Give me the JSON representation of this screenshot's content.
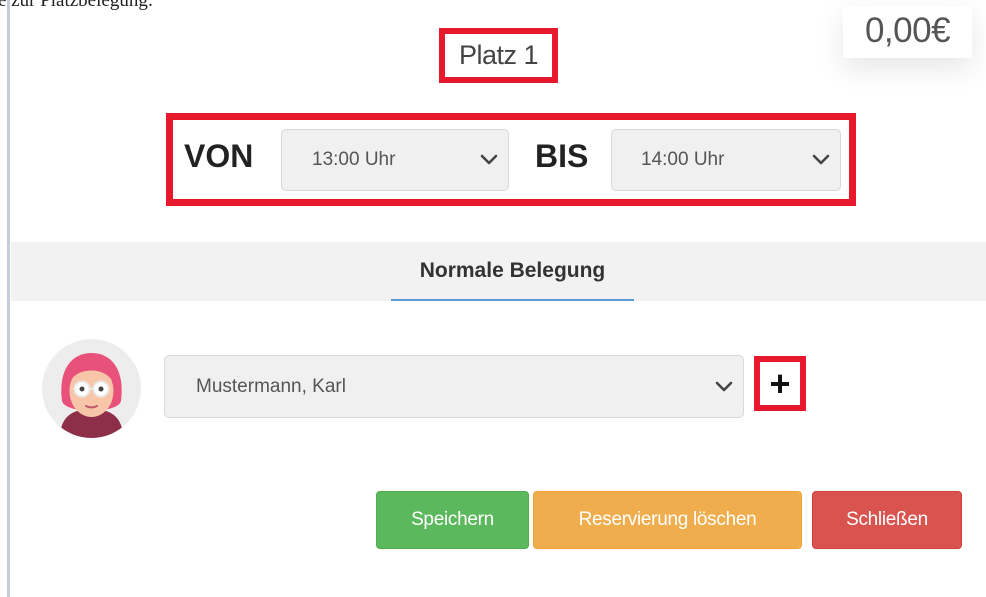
{
  "header": {
    "clipped_text": "e zur Platzbelegung:",
    "price": "0,00€",
    "place_title": "Platz 1"
  },
  "time": {
    "from_label": "VON",
    "from_value": "13:00 Uhr",
    "to_label": "BIS",
    "to_value": "14:00 Uhr"
  },
  "tabs": [
    {
      "label": "Normale Belegung",
      "active": true
    }
  ],
  "member": {
    "selected": "Mustermann, Karl",
    "add_label": "+"
  },
  "buttons": {
    "save": "Speichern",
    "delete": "Reservierung löschen",
    "close": "Schließen"
  },
  "colors": {
    "highlight": "#e8192c",
    "save": "#5cb85c",
    "delete": "#f0ad4e",
    "close": "#d9534f",
    "tab_underline": "#5a9bd5"
  }
}
